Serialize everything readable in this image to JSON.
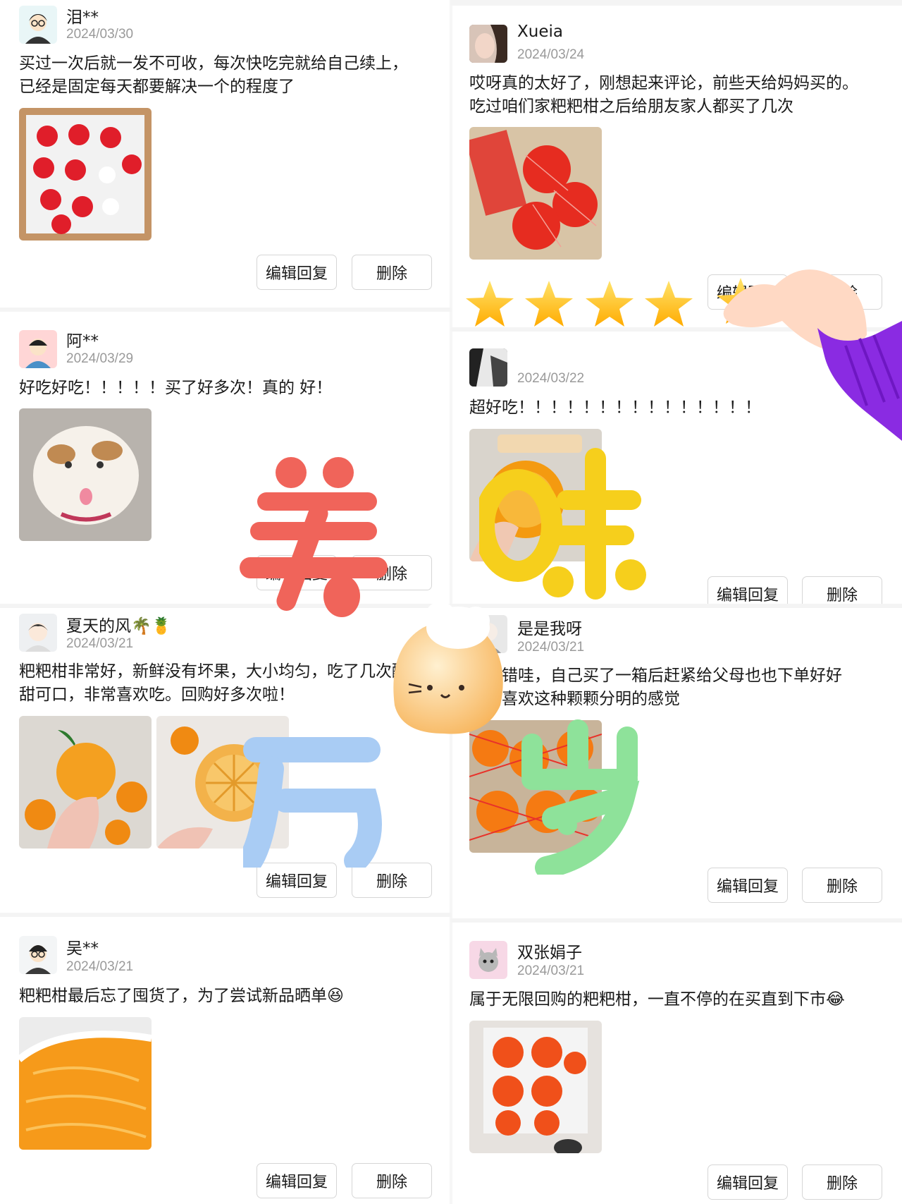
{
  "buttons": {
    "edit": "编辑回复",
    "delete": "删除"
  },
  "reviews": [
    {
      "name": "泪**",
      "date": "2024/03/30",
      "text": "买过一次后就一发不可收，每次快吃完就给自己续上，已经是固定每天都要解决一个的程度了",
      "photos": [
        "strawberries-in-foam-tray"
      ]
    },
    {
      "name": "Xueia",
      "date": "2024/03/24",
      "text": "哎呀真的太好了，刚想起来评论，前些天给妈妈买的。吃过咱们家粑粑柑之后给朋友家人都买了几次",
      "photos": [
        "netted-fruit-box"
      ]
    },
    {
      "name": "阿**",
      "date": "2024/03/29",
      "text": "好吃好吃！！！！！买了好多次！真的 好！",
      "photos": [
        "white-cat-tongue"
      ]
    },
    {
      "name": "",
      "date": "2024/03/22",
      "text": "超好吃！！！！！！！！！！！！！！！",
      "photos": [
        "caviar-orange"
      ]
    },
    {
      "name": "夏天的风🌴🍍",
      "date": "2024/03/21",
      "text": "粑粑柑非常好，新鲜没有坏果，大小均匀，吃了几次酸甜可口，非常喜欢吃。回购好多次啦！",
      "photos": [
        "orange-in-hand",
        "peeled-orange"
      ]
    },
    {
      "name": "是是我呀",
      "date": "2024/03/21",
      "text": "很不错哇，自己买了一箱后赶紧给父母也也下单好好吃，喜欢这种颗颗分明的感觉",
      "photos": [
        "netted-oranges"
      ]
    },
    {
      "name": "吴**",
      "date": "2024/03/21",
      "text": "粑粑柑最后忘了囤货了，为了尝试新品晒单😆",
      "photos": [
        "orange-segment-closeup"
      ]
    },
    {
      "name": "双张娟子",
      "date": "2024/03/21",
      "text": "属于无限回购的粑粑柑，一直不停的在买直到下市😂",
      "photos": [
        "oranges-box-top"
      ]
    }
  ],
  "decor": {
    "big_chars": [
      "美",
      "味",
      "万",
      "岁"
    ],
    "char_colors": [
      "#f0645a",
      "#f6cf1c",
      "#a9ccf4",
      "#8ee29a"
    ],
    "stars": 5,
    "star_color": "#ffc21a",
    "hand_color": "#ffd7c2",
    "sleeve_color": "#8b2be0",
    "mascot": "chef-cat-mascot"
  }
}
